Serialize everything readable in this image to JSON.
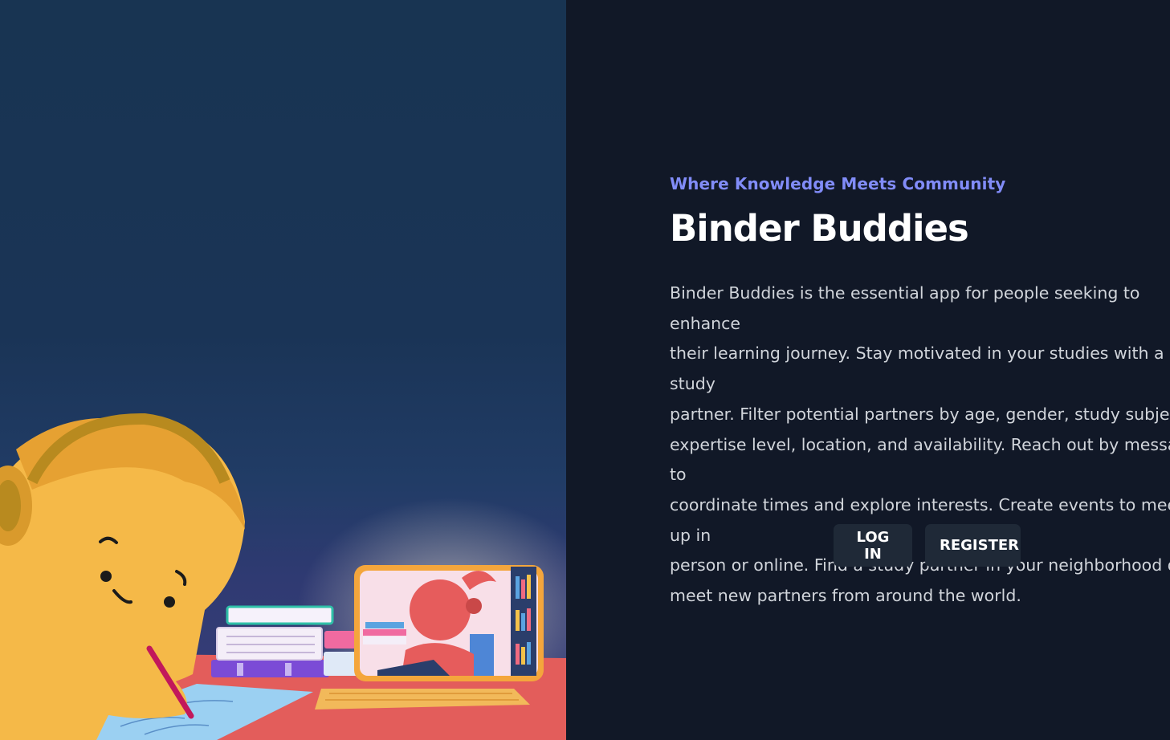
{
  "hero": {
    "image_description": "illustration",
    "illustration_icon": "student-studying-with-video-call-partner-illustration",
    "colors": {
      "background_top": "#183452",
      "background_bottom": "#3a3f7a",
      "desk": "#e35d5b",
      "student": "#f1b441",
      "partner": "#e65c5c"
    }
  },
  "main": {
    "tagline": "Where Knowledge Meets Community",
    "title": "Binder Buddies",
    "description": "Binder Buddies is the essential app for people seeking to enhance\ntheir learning journey. Stay motivated in your studies with a study\npartner. Filter potential partners by age, gender, study subject,\nexpertise level, location, and availability. Reach out by message to\ncoordinate times and explore interests. Create events to meet up in\nperson or online. Find a study partner in your neighborhood or\nmeet new partners from around the world."
  },
  "actions": {
    "login_label": "LOG IN",
    "register_label": "REGISTER"
  },
  "theme": {
    "page_background": "#111827",
    "accent": "#818cf8",
    "button_background": "#1f2937",
    "text_primary": "#ffffff",
    "text_secondary": "#d1d5db"
  }
}
